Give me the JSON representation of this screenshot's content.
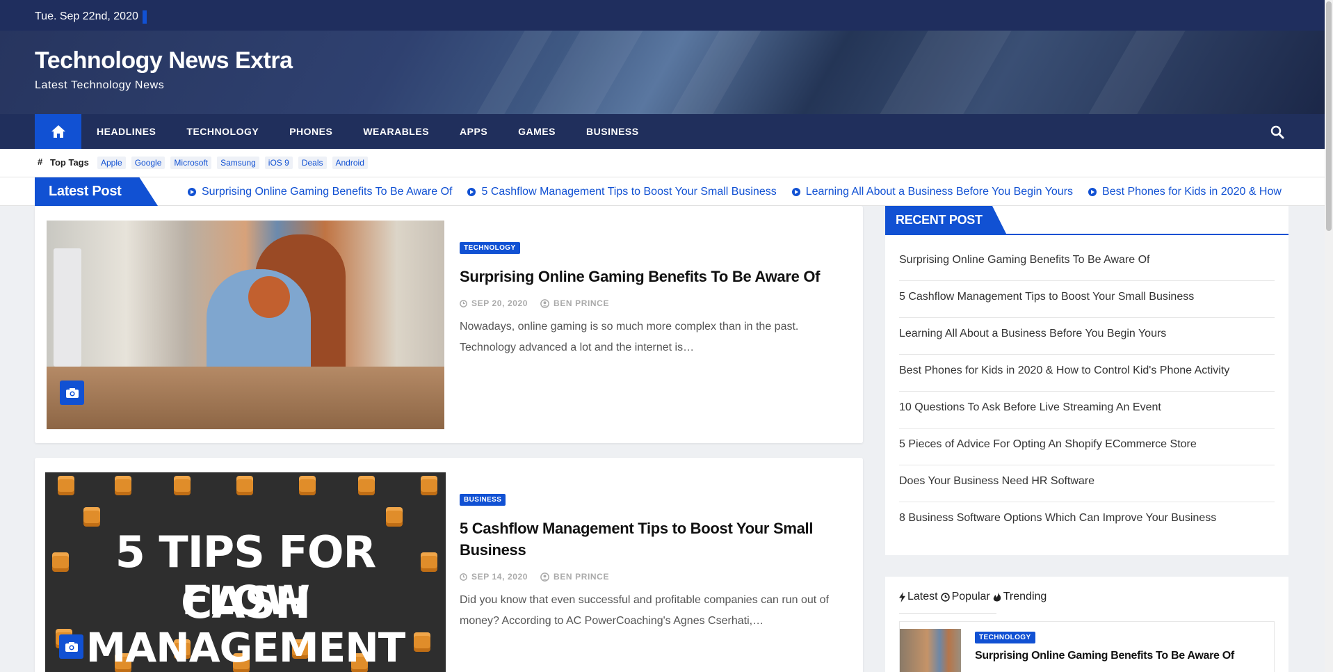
{
  "topbar": {
    "date": "Tue. Sep 22nd, 2020"
  },
  "site": {
    "title": "Technology News Extra",
    "tagline": "Latest Technology News"
  },
  "nav": {
    "items": [
      "HEADLINES",
      "TECHNOLOGY",
      "PHONES",
      "WEARABLES",
      "APPS",
      "GAMES",
      "BUSINESS"
    ],
    "home_icon": "home-icon",
    "search_icon": "search-icon"
  },
  "top_tags": {
    "label": "Top Tags",
    "tags": [
      "Apple",
      "Google",
      "Microsoft",
      "Samsung",
      "iOS 9",
      "Deals",
      "Android"
    ]
  },
  "ticker": {
    "label": "Latest Post",
    "items": [
      "Surprising Online Gaming Benefits To Be Aware Of",
      "5 Cashflow Management Tips to Boost Your Small Business",
      "Learning All About a Business Before You Begin Yours",
      "Best Phones for Kids in 2020 & How"
    ]
  },
  "posts": [
    {
      "category": "TECHNOLOGY",
      "title": "Surprising Online Gaming Benefits To Be Aware Of",
      "date": "SEP 20, 2020",
      "author": "BEN PRINCE",
      "excerpt_line1": "Nowadays, online gaming is so much more complex than in the past.",
      "excerpt_line2": "Technology advanced a lot and the internet is…"
    },
    {
      "category": "BUSINESS",
      "title_line1": "5 Cashflow Management Tips to Boost Your Small",
      "title_line2": "Business",
      "date": "SEP 14, 2020",
      "author": "BEN PRINCE",
      "excerpt_line1": "Did you know that even successful and profitable companies can run out of",
      "excerpt_line2": "money? According to AC PowerCoaching's Agnes Cserhati,…",
      "image_text_line1": "5 TIPS FOR CASH",
      "image_text_line2": "FLOW MANAGEMENT"
    }
  ],
  "recent": {
    "heading": "RECENT POST",
    "items": [
      "Surprising Online Gaming Benefits To Be Aware Of",
      "5 Cashflow Management Tips to Boost Your Small Business",
      "Learning All About a Business Before You Begin Yours",
      "Best Phones for Kids in 2020 & How to Control Kid's Phone Activity",
      "10 Questions To Ask Before Live Streaming An Event",
      "5 Pieces of Advice For Opting An Shopify ECommerce Store",
      "Does Your Business Need HR Software",
      "8 Business Software Options Which Can Improve Your Business"
    ]
  },
  "tabs": {
    "latest": "Latest",
    "popular": "Popular",
    "trending": "Trending",
    "post_category": "TECHNOLOGY",
    "post_title": "Surprising Online Gaming Benefits To Be Aware Of"
  },
  "colors": {
    "accent": "#1151d3",
    "nav_bg": "#202f5c",
    "topbar_bg": "#1f2e5e"
  }
}
